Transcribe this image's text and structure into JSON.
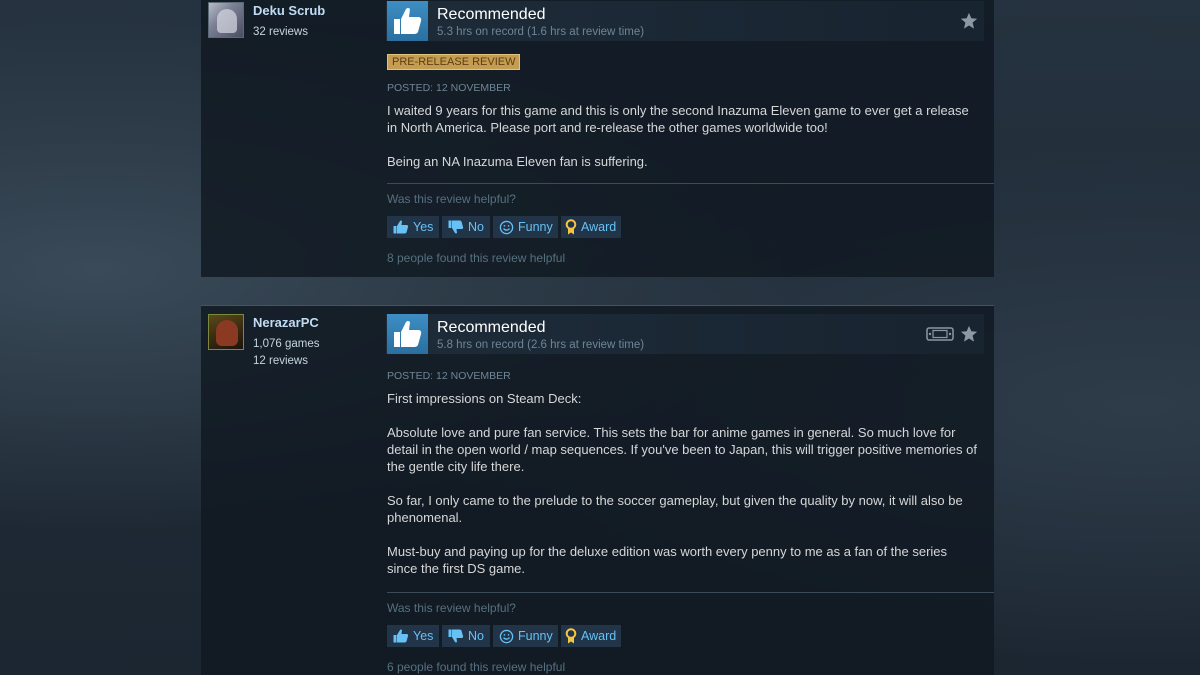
{
  "reviews": [
    {
      "author": {
        "name": "Deku Scrub",
        "stats": [
          "32 reviews"
        ]
      },
      "recommendation": "Recommended",
      "hours": "5.3 hrs on record (1.6 hrs at review time)",
      "badge": "PRE-RELEASE REVIEW",
      "posted": "Posted: 12 November",
      "paragraphs": [
        "I waited 9 years for this game and this is only the second Inazuma Eleven game to ever get a release in North America. Please port and re-release the other games worldwide too!",
        "Being an NA Inazuma Eleven fan is suffering."
      ],
      "helpful_question": "Was this review helpful?",
      "buttons": {
        "yes": "Yes",
        "no": "No",
        "funny": "Funny",
        "award": "Award"
      },
      "found_helpful": "8 people found this review helpful"
    },
    {
      "author": {
        "name": "NerazarPC",
        "stats": [
          "1,076 games",
          "12 reviews"
        ]
      },
      "recommendation": "Recommended",
      "hours": "5.8 hrs on record (2.6 hrs at review time)",
      "posted": "Posted: 12 November",
      "paragraphs": [
        "First impressions on Steam Deck:",
        "Absolute love and pure fan service. This sets the bar for anime games in general. So much love for detail in the open world / map sequences. If you've been to Japan, this will trigger positive memories of the gentle city life there.",
        "So far, I only came to the prelude to the soccer gameplay, but given the quality by now, it will also be phenomenal.",
        "Must-buy and paying up for the deluxe edition was worth every penny to me as a fan of the series since the first DS game."
      ],
      "helpful_question": "Was this review helpful?",
      "buttons": {
        "yes": "Yes",
        "no": "No",
        "funny": "Funny",
        "award": "Award"
      },
      "found_helpful": "6 people found this review helpful"
    }
  ],
  "colors": {
    "thumb_blue": "#3d8ec4",
    "link": "#67c1f5",
    "badge": "#c59d52",
    "award_gold": "#f5c542"
  }
}
